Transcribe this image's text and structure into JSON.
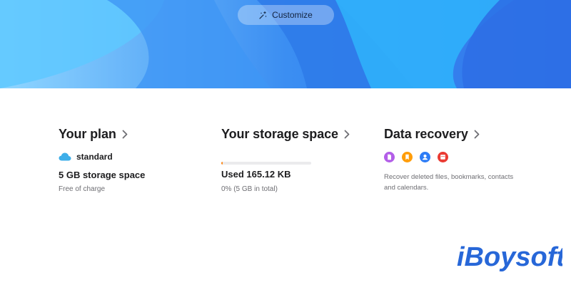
{
  "header": {
    "customize_label": "Customize"
  },
  "plan_card": {
    "title": "Your plan",
    "plan_name": "standard",
    "storage": "5 GB storage space",
    "price": "Free of charge"
  },
  "storage_card": {
    "title": "Your storage space",
    "used": "Used 165.12 KB",
    "detail": "0% (5 GB in total)",
    "progress_fraction": 0.01
  },
  "recovery_card": {
    "title": "Data recovery",
    "icons": [
      "files-icon",
      "bookmarks-icon",
      "contacts-icon",
      "calendars-icon"
    ],
    "description": "Recover deleted files, bookmarks, contacts and calendars."
  },
  "watermark": {
    "brand": "iBoysoft"
  },
  "colors": {
    "accent_blue": "#2f80f0",
    "cloud_blue": "#3daee9",
    "progress_orange": "#ff8a1a",
    "files_purple": "#b35ee8",
    "bookmarks_orange": "#ff9d0a",
    "contacts_blue": "#2d7cf6",
    "calendars_red": "#ea3b33",
    "logo_blue": "#2767d8"
  }
}
